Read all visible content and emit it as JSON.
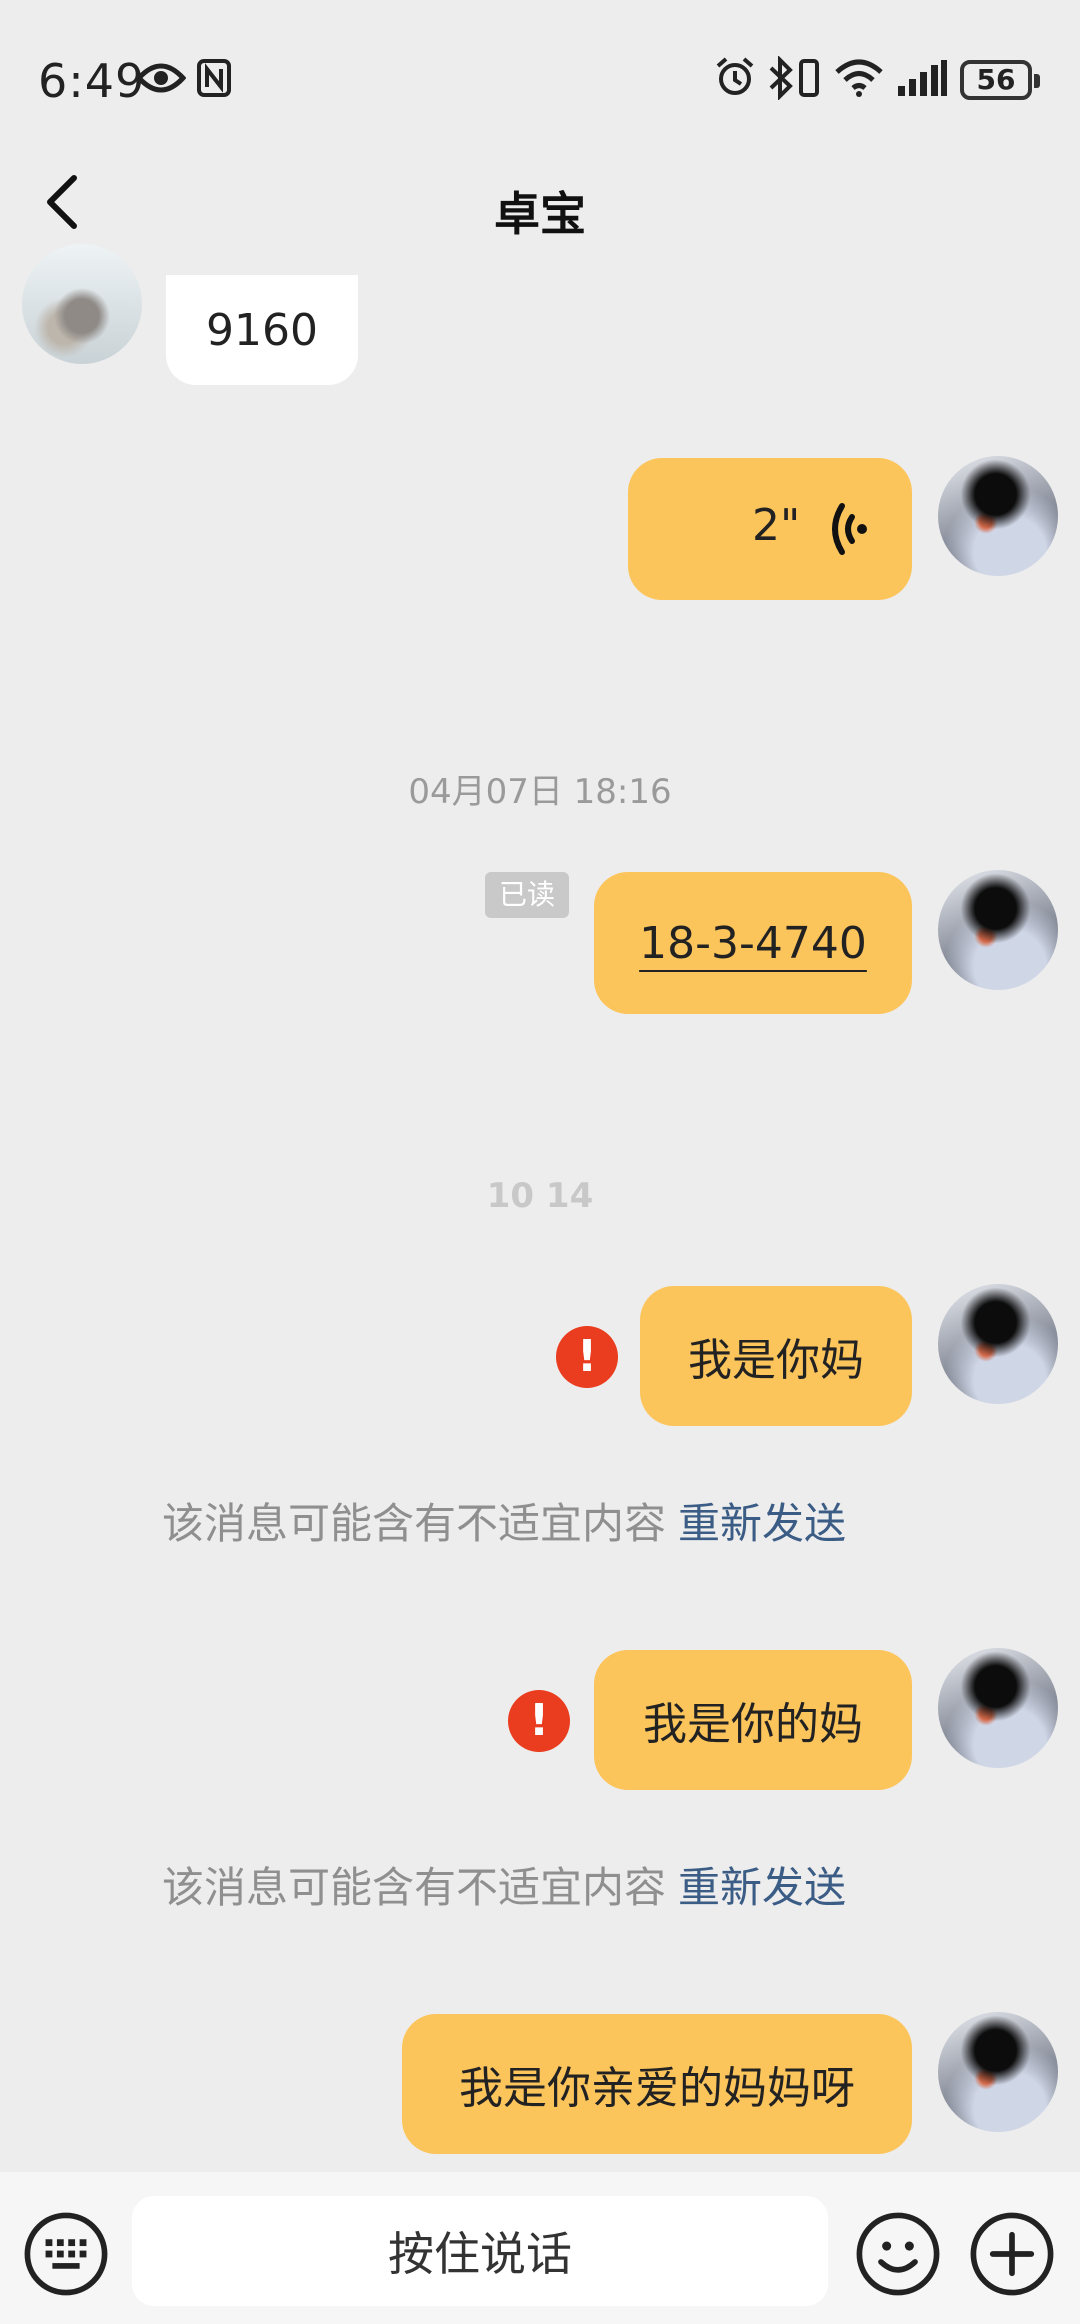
{
  "status_bar": {
    "time": "6:49",
    "battery": "56",
    "icons": [
      "eye-icon",
      "nfc-icon",
      "alarm-icon",
      "bluetooth-icon",
      "wifi-icon",
      "signal-icon",
      "battery-icon"
    ]
  },
  "header": {
    "title": "卓宝",
    "back_icon": "chevron-left-icon"
  },
  "messages": {
    "m1": {
      "from": "other",
      "text": "9160"
    },
    "m2": {
      "from": "me",
      "type": "voice",
      "duration": "2\""
    },
    "time1": "04月07日 18:16",
    "m3": {
      "from": "me",
      "text": "18-3-4740",
      "read": "已读"
    },
    "time2": "10 14",
    "m4": {
      "from": "me",
      "text": "我是你妈",
      "failed": true
    },
    "notice1": {
      "text": "该消息可能含有不适宜内容",
      "action": "重新发送"
    },
    "m5": {
      "from": "me",
      "text": "我是你的妈",
      "failed": true
    },
    "notice2": {
      "text": "该消息可能含有不适宜内容",
      "action": "重新发送"
    },
    "m6": {
      "from": "me",
      "text": "我是你亲爱的妈妈呀"
    }
  },
  "input_bar": {
    "hold_to_talk": "按住说话",
    "icons": [
      "keyboard-icon",
      "emoji-icon",
      "plus-icon"
    ]
  },
  "colors": {
    "background": "#ededed",
    "my_bubble": "#fcc55c",
    "their_bubble": "#ffffff",
    "warning": "#ea3c1e",
    "resend_link": "#3a5c85"
  }
}
